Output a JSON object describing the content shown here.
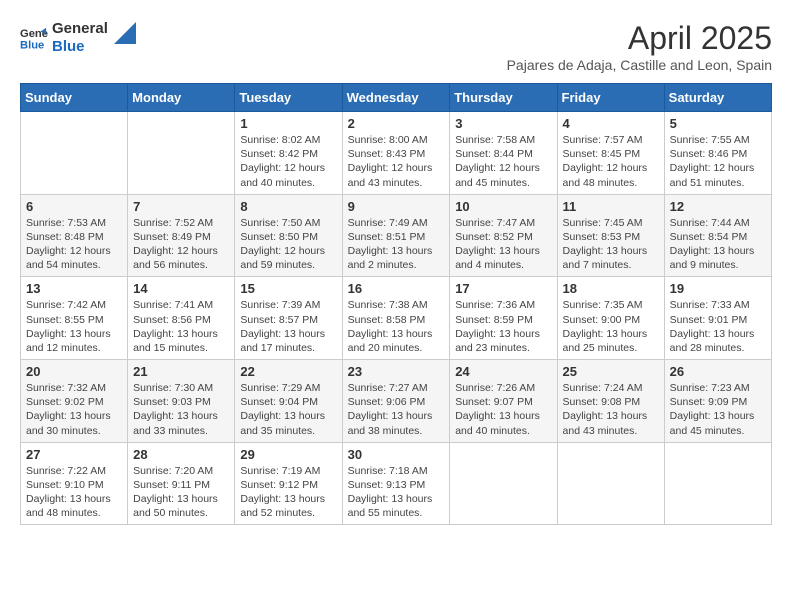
{
  "logo": {
    "line1": "General",
    "line2": "Blue"
  },
  "title": "April 2025",
  "subtitle": "Pajares de Adaja, Castille and Leon, Spain",
  "days_of_week": [
    "Sunday",
    "Monday",
    "Tuesday",
    "Wednesday",
    "Thursday",
    "Friday",
    "Saturday"
  ],
  "weeks": [
    [
      {
        "day": "",
        "info": ""
      },
      {
        "day": "",
        "info": ""
      },
      {
        "day": "1",
        "info": "Sunrise: 8:02 AM\nSunset: 8:42 PM\nDaylight: 12 hours and 40 minutes."
      },
      {
        "day": "2",
        "info": "Sunrise: 8:00 AM\nSunset: 8:43 PM\nDaylight: 12 hours and 43 minutes."
      },
      {
        "day": "3",
        "info": "Sunrise: 7:58 AM\nSunset: 8:44 PM\nDaylight: 12 hours and 45 minutes."
      },
      {
        "day": "4",
        "info": "Sunrise: 7:57 AM\nSunset: 8:45 PM\nDaylight: 12 hours and 48 minutes."
      },
      {
        "day": "5",
        "info": "Sunrise: 7:55 AM\nSunset: 8:46 PM\nDaylight: 12 hours and 51 minutes."
      }
    ],
    [
      {
        "day": "6",
        "info": "Sunrise: 7:53 AM\nSunset: 8:48 PM\nDaylight: 12 hours and 54 minutes."
      },
      {
        "day": "7",
        "info": "Sunrise: 7:52 AM\nSunset: 8:49 PM\nDaylight: 12 hours and 56 minutes."
      },
      {
        "day": "8",
        "info": "Sunrise: 7:50 AM\nSunset: 8:50 PM\nDaylight: 12 hours and 59 minutes."
      },
      {
        "day": "9",
        "info": "Sunrise: 7:49 AM\nSunset: 8:51 PM\nDaylight: 13 hours and 2 minutes."
      },
      {
        "day": "10",
        "info": "Sunrise: 7:47 AM\nSunset: 8:52 PM\nDaylight: 13 hours and 4 minutes."
      },
      {
        "day": "11",
        "info": "Sunrise: 7:45 AM\nSunset: 8:53 PM\nDaylight: 13 hours and 7 minutes."
      },
      {
        "day": "12",
        "info": "Sunrise: 7:44 AM\nSunset: 8:54 PM\nDaylight: 13 hours and 9 minutes."
      }
    ],
    [
      {
        "day": "13",
        "info": "Sunrise: 7:42 AM\nSunset: 8:55 PM\nDaylight: 13 hours and 12 minutes."
      },
      {
        "day": "14",
        "info": "Sunrise: 7:41 AM\nSunset: 8:56 PM\nDaylight: 13 hours and 15 minutes."
      },
      {
        "day": "15",
        "info": "Sunrise: 7:39 AM\nSunset: 8:57 PM\nDaylight: 13 hours and 17 minutes."
      },
      {
        "day": "16",
        "info": "Sunrise: 7:38 AM\nSunset: 8:58 PM\nDaylight: 13 hours and 20 minutes."
      },
      {
        "day": "17",
        "info": "Sunrise: 7:36 AM\nSunset: 8:59 PM\nDaylight: 13 hours and 23 minutes."
      },
      {
        "day": "18",
        "info": "Sunrise: 7:35 AM\nSunset: 9:00 PM\nDaylight: 13 hours and 25 minutes."
      },
      {
        "day": "19",
        "info": "Sunrise: 7:33 AM\nSunset: 9:01 PM\nDaylight: 13 hours and 28 minutes."
      }
    ],
    [
      {
        "day": "20",
        "info": "Sunrise: 7:32 AM\nSunset: 9:02 PM\nDaylight: 13 hours and 30 minutes."
      },
      {
        "day": "21",
        "info": "Sunrise: 7:30 AM\nSunset: 9:03 PM\nDaylight: 13 hours and 33 minutes."
      },
      {
        "day": "22",
        "info": "Sunrise: 7:29 AM\nSunset: 9:04 PM\nDaylight: 13 hours and 35 minutes."
      },
      {
        "day": "23",
        "info": "Sunrise: 7:27 AM\nSunset: 9:06 PM\nDaylight: 13 hours and 38 minutes."
      },
      {
        "day": "24",
        "info": "Sunrise: 7:26 AM\nSunset: 9:07 PM\nDaylight: 13 hours and 40 minutes."
      },
      {
        "day": "25",
        "info": "Sunrise: 7:24 AM\nSunset: 9:08 PM\nDaylight: 13 hours and 43 minutes."
      },
      {
        "day": "26",
        "info": "Sunrise: 7:23 AM\nSunset: 9:09 PM\nDaylight: 13 hours and 45 minutes."
      }
    ],
    [
      {
        "day": "27",
        "info": "Sunrise: 7:22 AM\nSunset: 9:10 PM\nDaylight: 13 hours and 48 minutes."
      },
      {
        "day": "28",
        "info": "Sunrise: 7:20 AM\nSunset: 9:11 PM\nDaylight: 13 hours and 50 minutes."
      },
      {
        "day": "29",
        "info": "Sunrise: 7:19 AM\nSunset: 9:12 PM\nDaylight: 13 hours and 52 minutes."
      },
      {
        "day": "30",
        "info": "Sunrise: 7:18 AM\nSunset: 9:13 PM\nDaylight: 13 hours and 55 minutes."
      },
      {
        "day": "",
        "info": ""
      },
      {
        "day": "",
        "info": ""
      },
      {
        "day": "",
        "info": ""
      }
    ]
  ]
}
